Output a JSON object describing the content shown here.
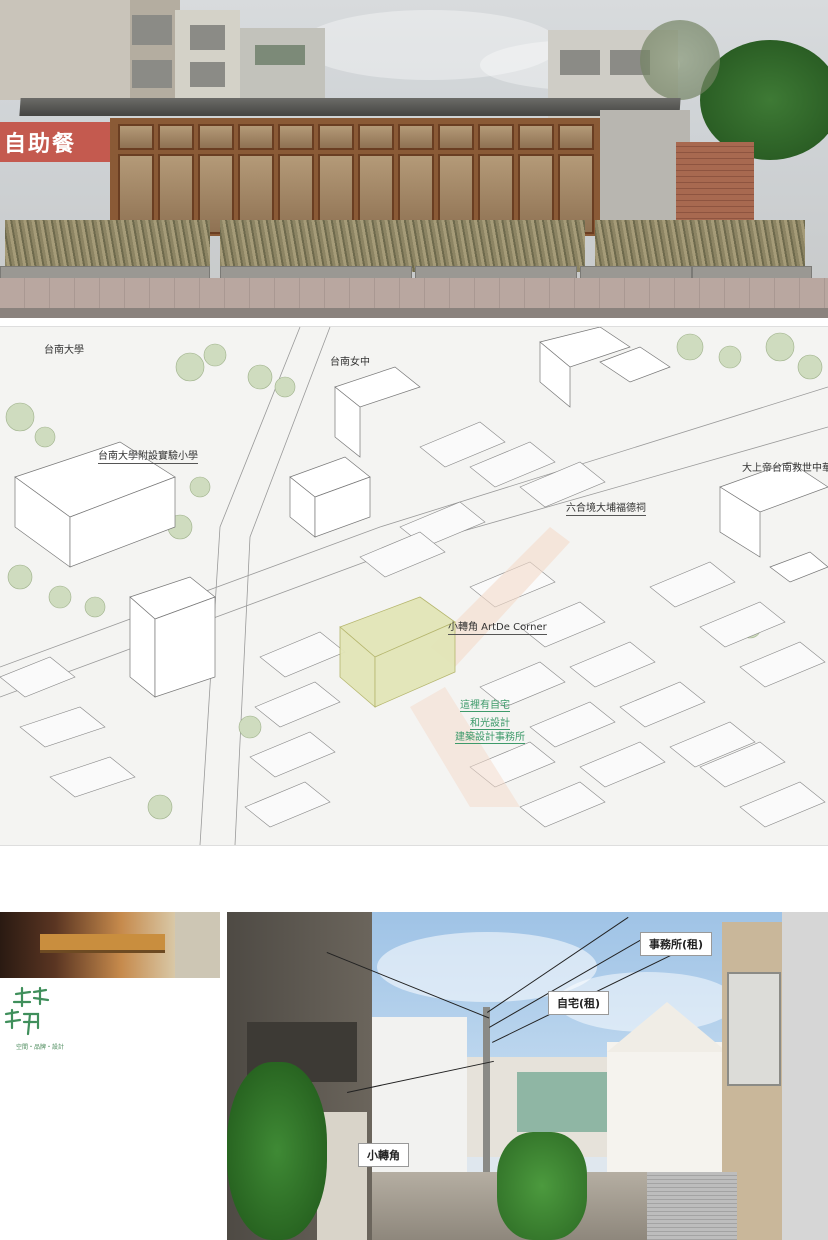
{
  "top_photo": {
    "sign_text": "自助餐"
  },
  "map": {
    "labels": [
      "台南大學",
      "台南女中",
      "台南大學附設實驗小學",
      "六合境大埔福德祠",
      "大上帝台南救世中華總會",
      "小轉角 ArtDe Corner",
      "這裡有自宅",
      "和光設計",
      "建築設計事務所"
    ]
  },
  "bottom_left": {
    "logo_tagline": "空間・品牌・設計"
  },
  "bottom_right": {
    "callouts": {
      "office": "事務所(租)",
      "home": "自宅(租)",
      "corner": "小轉角"
    }
  }
}
